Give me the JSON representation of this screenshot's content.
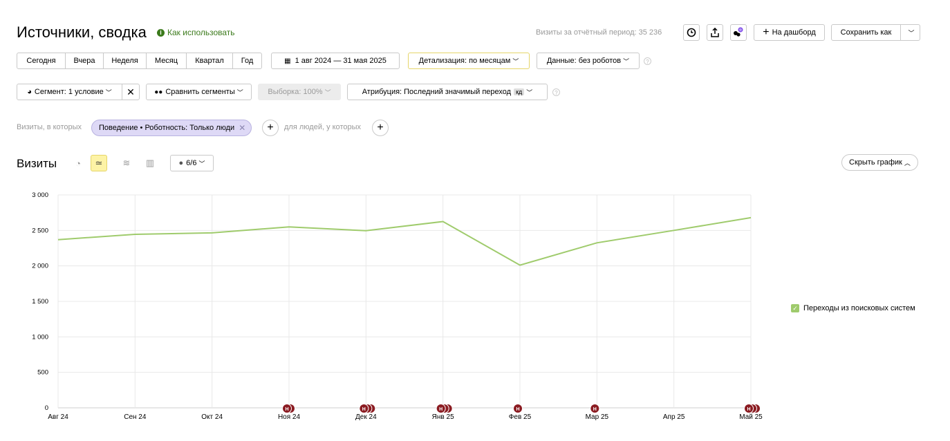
{
  "header": {
    "title": "Источники, сводка",
    "how_to_use": "Как использовать",
    "visits_total_label": "Визиты за отчётный период: 35 236",
    "add_dashboard": "На дашборд",
    "save_as": "Сохранить как"
  },
  "period_buttons": [
    "Сегодня",
    "Вчера",
    "Неделя",
    "Месяц",
    "Квартал",
    "Год"
  ],
  "date_range": "1 авг 2024 — 31 мая 2025",
  "detail": "Детализация: по месяцам",
  "data_filter": "Данные: без роботов",
  "segment": "Сегмент: 1 условие",
  "compare_segments": "Сравнить сегменты",
  "sample": "Выборка: 100%",
  "attribution": "Атрибуция: Последний значимый переход",
  "attribution_badge": "кд",
  "filters": {
    "visits_label": "Визиты, в которых",
    "chip": "Поведение • Роботность: Только люди",
    "people_label": "для людей, у которых"
  },
  "chart_header": {
    "title": "Визиты",
    "series_count": "6/6",
    "hide_chart": "Скрыть график"
  },
  "chart_data": {
    "type": "line",
    "categories": [
      "Авг 24",
      "Сен 24",
      "Окт 24",
      "Ноя 24",
      "Дек 24",
      "Янв 25",
      "Фев 25",
      "Мар 25",
      "Апр 25",
      "Май 25"
    ],
    "series": [
      {
        "name": "Переходы из поисковых систем",
        "color": "#9fcb6c",
        "values": [
          2370,
          2445,
          2465,
          2550,
          2495,
          2625,
          2010,
          2325,
          2500,
          2680
        ]
      }
    ],
    "yticks": [
      "0",
      "500",
      "1 000",
      "1 500",
      "2 000",
      "2 500",
      "3 000"
    ],
    "ylim": [
      0,
      3000
    ],
    "annotation_marker": "Н",
    "annotation_counts": [
      0,
      0,
      0,
      2,
      3,
      3,
      1,
      1,
      0,
      3
    ],
    "grid": true,
    "legend_position": "right"
  }
}
